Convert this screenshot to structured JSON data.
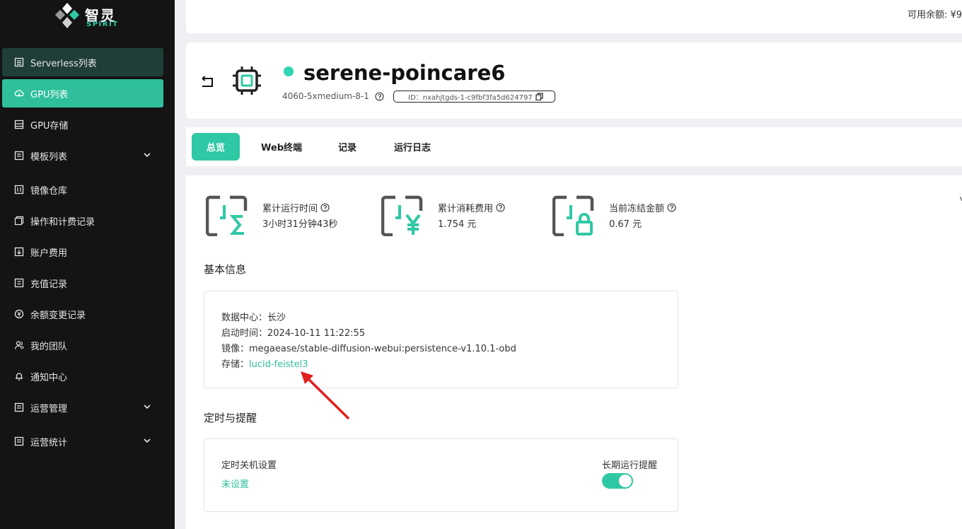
{
  "brand": {
    "name_cn": "智灵",
    "name_en": "SPIRIT"
  },
  "sidebar": {
    "items": [
      {
        "label": "Serverless列表",
        "icon": "list-icon"
      },
      {
        "label": "GPU列表",
        "icon": "cloud-icon"
      },
      {
        "label": "GPU存储",
        "icon": "storage-icon"
      },
      {
        "label": "模板列表",
        "icon": "template-icon"
      },
      {
        "label": "镜像仓库",
        "icon": "image-repo-icon"
      },
      {
        "label": "操作和计费记录",
        "icon": "records-icon"
      },
      {
        "label": "账户费用",
        "icon": "account-fee-icon"
      },
      {
        "label": "充值记录",
        "icon": "recharge-icon"
      },
      {
        "label": "余额变更记录",
        "icon": "balance-change-icon"
      },
      {
        "label": "我的团队",
        "icon": "team-icon"
      },
      {
        "label": "通知中心",
        "icon": "bell-icon"
      },
      {
        "label": "运营管理",
        "icon": "ops-icon"
      },
      {
        "label": "运营统计",
        "icon": "stats-icon"
      }
    ]
  },
  "header": {
    "balance": "可用余额: ¥9"
  },
  "instance": {
    "name": "serene-poincare6",
    "spec": "4060-5xmedium-8-1",
    "id_text": "ID：nxahjtgds-1-c9fbf3fa5d624797"
  },
  "tabs": [
    "总览",
    "Web终端",
    "记录",
    "运行日志"
  ],
  "stats": [
    {
      "label": "累计运行时间",
      "value": "3小时31分钟43秒"
    },
    {
      "label": "累计消耗费用",
      "value": "1.754 元"
    },
    {
      "label": "当前冻结金额",
      "value": "0.67 元"
    }
  ],
  "basic_info": {
    "title": "基本信息",
    "datacenter_label": "数据中心：",
    "datacenter": "长沙",
    "start_label": "启动时间：",
    "start_time": "2024-10-11 11:22:55",
    "image_label": "镜像：",
    "image": "megaease/stable-diffusion-webui:persistence-v1.10.1-obd",
    "storage_label": "存储：",
    "storage": "lucid-feistel3"
  },
  "schedule": {
    "title": "定时与提醒",
    "shutdown_label": "定时关机设置",
    "shutdown_value": "未设置",
    "long_run_label": "长期运行提醒"
  },
  "colors": {
    "accent": "#2fc8a5",
    "sidebar_bg": "#141414",
    "annotation_arrow": "#e02020"
  }
}
